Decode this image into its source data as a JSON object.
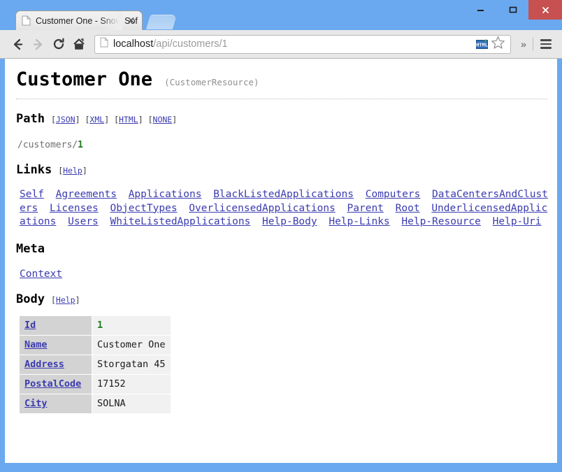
{
  "window": {
    "minimize_label": "minimize-icon",
    "maximize_label": "maximize-icon",
    "close_label": "close-icon"
  },
  "tab": {
    "title": "Customer One - Snow Sof",
    "close_glyph": "✕",
    "favicon": "page-icon"
  },
  "toolbar": {
    "back": "←",
    "forward": "→",
    "reload": "reload-icon",
    "home": "home-icon",
    "chevron": "»",
    "menu": "hamburger-icon"
  },
  "omnibox": {
    "host": "localhost",
    "path": "/api/customers/1",
    "validator_label": "HTML",
    "star": "bookmark-star-icon"
  },
  "page": {
    "title": "Customer One",
    "subtitle": "(CustomerResource)",
    "path_section": {
      "heading": "Path",
      "formats": [
        "JSON",
        "XML",
        "HTML",
        "NONE"
      ],
      "value_prefix": "/customers/",
      "value_id": "1"
    },
    "links_section": {
      "heading": "Links",
      "help": "Help",
      "items": [
        "Self",
        "Agreements",
        "Applications",
        "BlackListedApplications",
        "Computers",
        "DataCentersAndClusters",
        "Licenses",
        "ObjectTypes",
        "OverlicensedApplications",
        "Parent",
        "Root",
        "UnderlicensedApplications",
        "Users",
        "WhiteListedApplications",
        "Help-Body",
        "Help-Links",
        "Help-Resource",
        "Help-Uri"
      ]
    },
    "meta_section": {
      "heading": "Meta",
      "items": [
        "Context"
      ]
    },
    "body_section": {
      "heading": "Body",
      "help": "Help",
      "rows": [
        {
          "key": "Id",
          "value": "1",
          "numeric": true
        },
        {
          "key": "Name",
          "value": "Customer One",
          "numeric": false
        },
        {
          "key": "Address",
          "value": "Storgatan 45",
          "numeric": false
        },
        {
          "key": "PostalCode",
          "value": "17152",
          "numeric": false
        },
        {
          "key": "City",
          "value": "SOLNA",
          "numeric": false
        }
      ]
    }
  },
  "colors": {
    "titlebar": "#6aa9ef",
    "close_button": "#c75050",
    "link": "#3b3bb0",
    "numeric": "#1f7a1f",
    "table_key_bg": "#d3d3d3",
    "table_value_bg": "#f1f1f1"
  }
}
